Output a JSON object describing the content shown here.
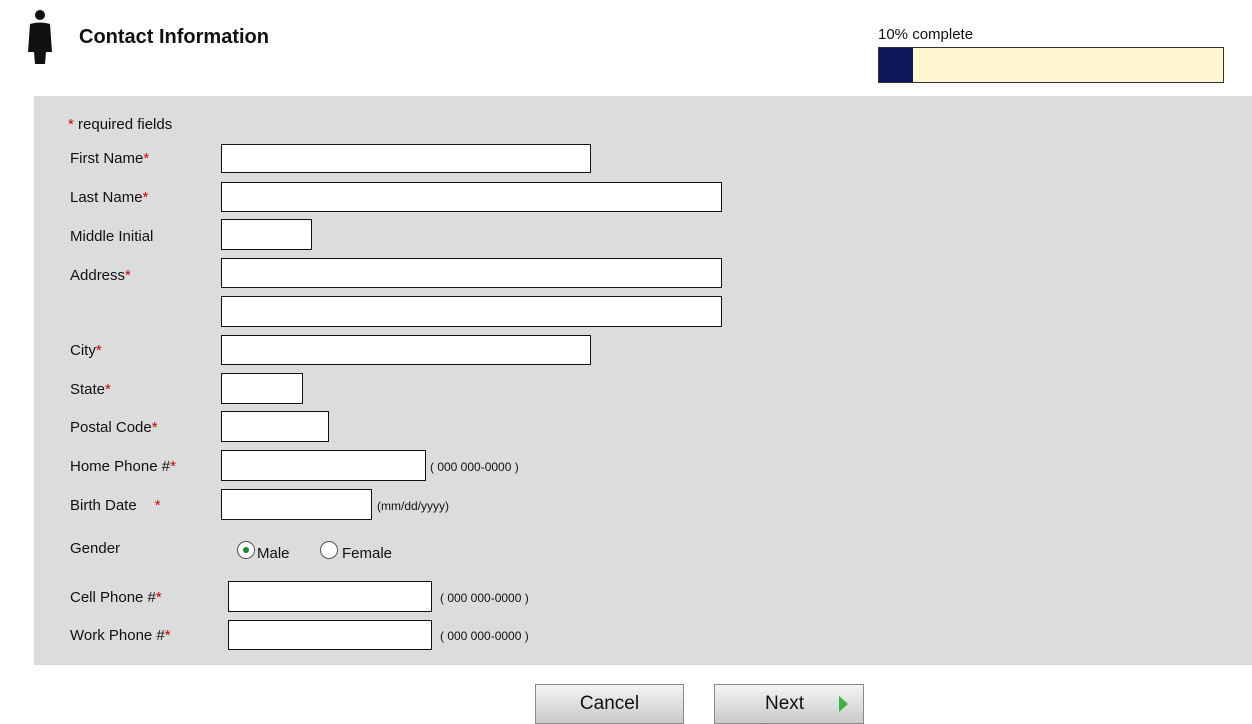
{
  "header": {
    "title": "Contact Information",
    "icon": "person-icon",
    "progress_label": "10% complete",
    "progress_fraction": 0.1,
    "progress_color": "#0c175c",
    "progress_track_color": "#fff6d2"
  },
  "form": {
    "required_star": "*",
    "required_note": "required fields",
    "labels": {
      "first_name": "First Name",
      "last_name": "Last Name",
      "middle_initial": "Middle Initial",
      "address": "Address",
      "city": "City",
      "state": "State",
      "postal_code": "Postal Code",
      "home_phone": "Home Phone #",
      "birth_date": "Birth Date",
      "gender": "Gender",
      "cell_phone": "Cell Phone #",
      "work_phone": "Work Phone #"
    },
    "values": {
      "first_name": "",
      "last_name": "",
      "middle_initial": "",
      "address_1": "",
      "address_2": "",
      "city": "",
      "state": "",
      "postal_code": "",
      "home_phone": "",
      "birth_date": "",
      "cell_phone": "",
      "work_phone": ""
    },
    "hints": {
      "home_phone": "( 000 000-0000 )",
      "birth_date": "(mm/dd/yyyy)",
      "cell_phone": "( 000 000-0000 )",
      "work_phone": "( 000 000-0000 )"
    },
    "gender_options": [
      "Male",
      "Female"
    ],
    "gender_selected": "Male"
  },
  "buttons": {
    "cancel": "Cancel",
    "next": "Next"
  },
  "colors": {
    "panel_bg": "#dcdcdc",
    "required_star": "#cc0000",
    "next_arrow": "#3cb043"
  }
}
